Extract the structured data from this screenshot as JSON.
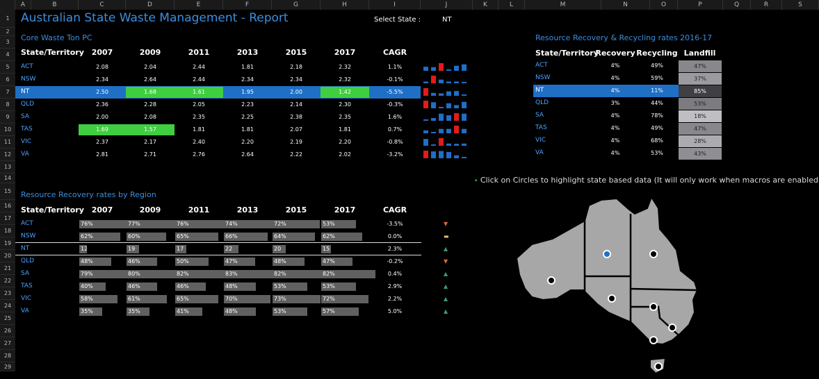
{
  "columns": [
    "A",
    "B",
    "C",
    "D",
    "E",
    "F",
    "G",
    "H",
    "I",
    "J",
    "K",
    "L",
    "M",
    "N",
    "O",
    "P",
    "Q",
    "R",
    "S"
  ],
  "rows": [
    "1",
    "2",
    "3",
    "4",
    "5",
    "6",
    "7",
    "8",
    "9",
    "10",
    "11",
    "12",
    "13",
    "14",
    "15",
    "16",
    "17",
    "18",
    "19",
    "20",
    "21",
    "22",
    "23",
    "24",
    "25",
    "26",
    "27",
    "28",
    "29"
  ],
  "title": "Australian State Waste Management - Report",
  "select_label": "Select State :",
  "select_value": "NT",
  "core": {
    "heading": "Core Waste Ton PC",
    "headers": [
      "State/Territory",
      "2007",
      "2009",
      "2011",
      "2013",
      "2015",
      "2017",
      "CAGR"
    ],
    "rows": [
      {
        "state": "ACT",
        "values": [
          "2.08",
          "2.04",
          "2.44",
          "1.81",
          "2.18",
          "2.32"
        ],
        "cagr": "1.1%"
      },
      {
        "state": "NSW",
        "values": [
          "2.34",
          "2.64",
          "2.44",
          "2.34",
          "2.34",
          "2.32"
        ],
        "cagr": "-0.1%"
      },
      {
        "state": "NT",
        "values": [
          "2.50",
          "1.68",
          "1.61",
          "1.95",
          "2.00",
          "1.42"
        ],
        "cagr": "-5.5%"
      },
      {
        "state": "QLD",
        "values": [
          "2.36",
          "2.28",
          "2.05",
          "2.23",
          "2.14",
          "2.30"
        ],
        "cagr": "-0.3%"
      },
      {
        "state": "SA",
        "values": [
          "2.00",
          "2.08",
          "2.35",
          "2.25",
          "2.38",
          "2.35"
        ],
        "cagr": "1.6%"
      },
      {
        "state": "TAS",
        "values": [
          "1.69",
          "1.57",
          "1.81",
          "1.81",
          "2.07",
          "1.81"
        ],
        "cagr": "0.7%"
      },
      {
        "state": "VIC",
        "values": [
          "2.37",
          "2.17",
          "2.40",
          "2.20",
          "2.19",
          "2.20"
        ],
        "cagr": "-0.8%"
      },
      {
        "state": "VA",
        "values": [
          "2.81",
          "2.71",
          "2.76",
          "2.64",
          "2.22",
          "2.02"
        ],
        "cagr": "-3.2%"
      }
    ]
  },
  "recycling": {
    "heading": "Resource Recovery & Recycling rates 2016-17",
    "headers": [
      "State/Territory",
      "Recovery",
      "Recycling",
      "Landfill"
    ],
    "rows": [
      {
        "state": "ACT",
        "recovery": "4%",
        "recycling": "49%",
        "landfill": "47%"
      },
      {
        "state": "NSW",
        "recovery": "4%",
        "recycling": "59%",
        "landfill": "37%"
      },
      {
        "state": "NT",
        "recovery": "4%",
        "recycling": "11%",
        "landfill": "85%"
      },
      {
        "state": "QLD",
        "recovery": "3%",
        "recycling": "44%",
        "landfill": "53%"
      },
      {
        "state": "SA",
        "recovery": "4%",
        "recycling": "78%",
        "landfill": "18%"
      },
      {
        "state": "TAS",
        "recovery": "4%",
        "recycling": "49%",
        "landfill": "47%"
      },
      {
        "state": "VIC",
        "recovery": "4%",
        "recycling": "68%",
        "landfill": "28%"
      },
      {
        "state": "VA",
        "recovery": "4%",
        "recycling": "53%",
        "landfill": "43%"
      }
    ]
  },
  "region": {
    "heading": "Resource Recovery rates by Region",
    "headers": [
      "State/Territory",
      "2007",
      "2009",
      "2011",
      "2013",
      "2015",
      "2017",
      "CAGR"
    ],
    "rows": [
      {
        "state": "ACT",
        "values": [
          "76%",
          "77%",
          "76%",
          "74%",
          "72%",
          "53%"
        ],
        "cagr": "-3.5%",
        "trend": "down"
      },
      {
        "state": "NSW",
        "values": [
          "62%",
          "60%",
          "65%",
          "66%",
          "64%",
          "62%"
        ],
        "cagr": "0.0%",
        "trend": "flat"
      },
      {
        "state": "NT",
        "values": [
          "12",
          "19",
          "17",
          "22",
          "20",
          "15"
        ],
        "cagr": "2.3%",
        "trend": "up"
      },
      {
        "state": "QLD",
        "values": [
          "48%",
          "46%",
          "50%",
          "47%",
          "48%",
          "47%"
        ],
        "cagr": "-0.2%",
        "trend": "down"
      },
      {
        "state": "SA",
        "values": [
          "79%",
          "80%",
          "82%",
          "83%",
          "82%",
          "82%"
        ],
        "cagr": "0.4%",
        "trend": "up"
      },
      {
        "state": "TAS",
        "values": [
          "40%",
          "46%",
          "46%",
          "48%",
          "53%",
          "53%"
        ],
        "cagr": "2.9%",
        "trend": "up"
      },
      {
        "state": "VIC",
        "values": [
          "58%",
          "61%",
          "65%",
          "70%",
          "73%",
          "72%"
        ],
        "cagr": "2.2%",
        "trend": "up"
      },
      {
        "state": "VA",
        "values": [
          "35%",
          "35%",
          "41%",
          "48%",
          "53%",
          "57%"
        ],
        "cagr": "5.0%",
        "trend": "up"
      }
    ],
    "bar_levels": [
      [
        76,
        77,
        76,
        74,
        72,
        53
      ],
      [
        62,
        60,
        65,
        66,
        64,
        62
      ],
      [
        12,
        19,
        17,
        22,
        20,
        15
      ],
      [
        48,
        46,
        50,
        47,
        48,
        47
      ],
      [
        79,
        80,
        82,
        83,
        82,
        82
      ],
      [
        40,
        46,
        46,
        48,
        53,
        53
      ],
      [
        58,
        61,
        65,
        70,
        73,
        72
      ],
      [
        35,
        35,
        41,
        48,
        53,
        57
      ]
    ]
  },
  "note": "Click on Circles to highlight state based data (It will only work when macros are enabled)",
  "colors": {
    "accent": "#3b8fe0",
    "highlight_row": "#1f6fc5",
    "green": "#3fce3f",
    "red": "#e21b1b",
    "bar": "#606060",
    "map": "#a7a7a7"
  }
}
